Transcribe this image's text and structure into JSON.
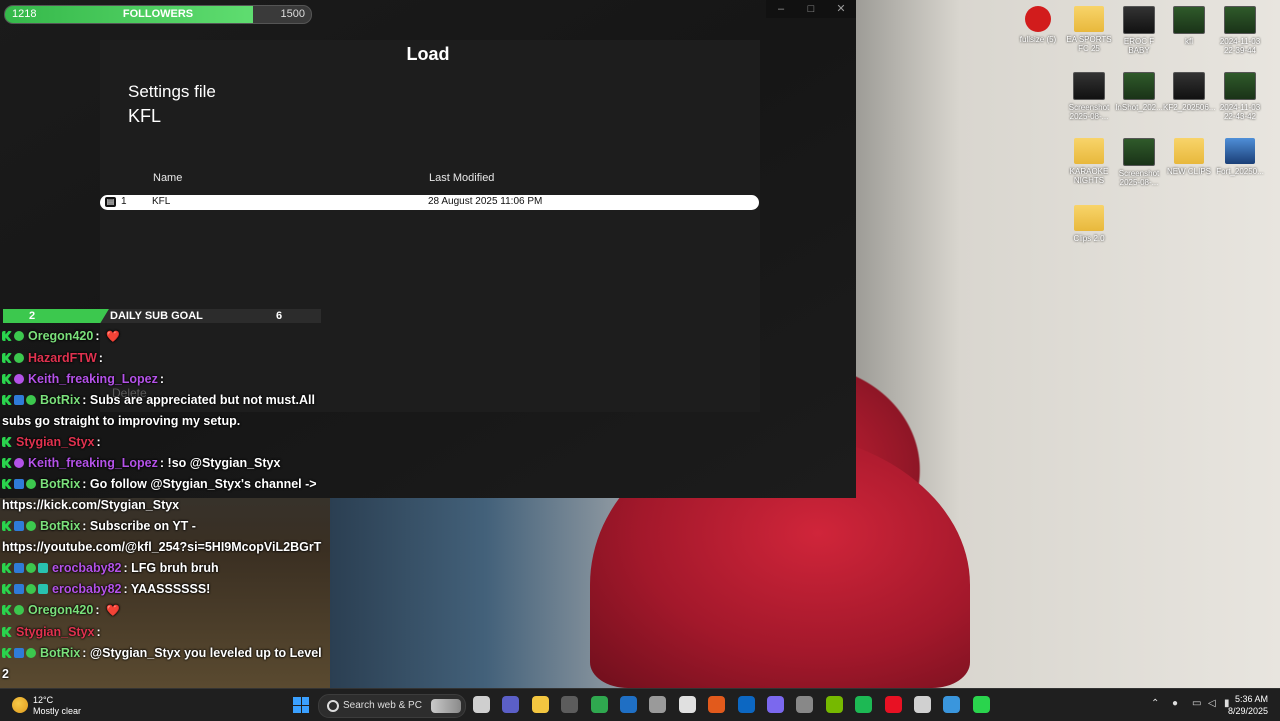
{
  "load_window": {
    "title": "Load",
    "settings_label": "Settings file",
    "settings_name": "KFL",
    "columns": {
      "name": "Name",
      "last_modified": "Last Modified"
    },
    "rows": [
      {
        "index": "1",
        "name": "KFL",
        "modified": "28 August 2025 11:06 PM"
      }
    ],
    "delete_label": "Delete",
    "controls": {
      "minimize": "–",
      "maximize": "□",
      "close": "✕"
    }
  },
  "followers": {
    "current": "1218",
    "label": "FOLLOWERS",
    "goal": "1500",
    "progress": 0.812
  },
  "sub_goal": {
    "current": "2",
    "label": "DAILY SUB GOAL",
    "goal": "6",
    "progress": 0.333
  },
  "chat": [
    {
      "badges": [
        "kick",
        "check"
      ],
      "name": "Oregon420",
      "color": "#7be07b",
      "msg": "",
      "emote": "❤️"
    },
    {
      "badges": [
        "kick",
        "check"
      ],
      "name": "HazardFTW",
      "color": "#e0324f",
      "msg": "",
      "emote": ""
    },
    {
      "badges": [
        "kick",
        "mic"
      ],
      "name": "Keith_freaking_Lopez",
      "color": "#b452e8",
      "msg": "",
      "emote": ""
    },
    {
      "badges": [
        "kick",
        "bot",
        "check"
      ],
      "name": "BotRix",
      "color": "#7be07b",
      "msg": "Subs are appreciated but not must.All subs go straight to improving my setup.",
      "emote": ""
    },
    {
      "badges": [
        "kick"
      ],
      "name": "Stygian_Styx",
      "color": "#e0324f",
      "msg": "",
      "emote": ""
    },
    {
      "badges": [
        "kick",
        "mic"
      ],
      "name": "Keith_freaking_Lopez",
      "color": "#b452e8",
      "msg": "!so @Stygian_Styx",
      "emote": ""
    },
    {
      "badges": [
        "kick",
        "bot",
        "check"
      ],
      "name": "BotRix",
      "color": "#7be07b",
      "msg": "Go follow @Stygian_Styx's channel -> https://kick.com/Stygian_Styx",
      "emote": ""
    },
    {
      "badges": [
        "kick",
        "bot",
        "check"
      ],
      "name": "BotRix",
      "color": "#7be07b",
      "msg": "Subscribe on YT - https://youtube.com/@kfl_254?si=5HI9McopViL2BGrT",
      "emote": ""
    },
    {
      "badges": [
        "kick",
        "bot",
        "check",
        "gift"
      ],
      "name": "erocbaby82",
      "color": "#b452e8",
      "msg": "LFG bruh bruh",
      "emote": ""
    },
    {
      "badges": [
        "kick",
        "bot",
        "check",
        "gift"
      ],
      "name": "erocbaby82",
      "color": "#b452e8",
      "msg": "YAASSSSSS!",
      "emote": ""
    },
    {
      "badges": [
        "kick",
        "check"
      ],
      "name": "Oregon420",
      "color": "#7be07b",
      "msg": "",
      "emote": "❤️"
    },
    {
      "badges": [
        "kick"
      ],
      "name": "Stygian_Styx",
      "color": "#e0324f",
      "msg": "",
      "emote": ""
    },
    {
      "badges": [
        "kick",
        "bot",
        "check"
      ],
      "name": "BotRix",
      "color": "#7be07b",
      "msg": "@Stygian_Styx you leveled up to Level 2",
      "emote": ""
    }
  ],
  "desktop_icons": [
    {
      "label": "fullsize (5)",
      "kind": "red"
    },
    {
      "label": "EA SPORTS FC 25",
      "kind": "folder"
    },
    {
      "label": "EROC F BABY",
      "kind": "video"
    },
    {
      "label": "kfl",
      "kind": "green"
    },
    {
      "label": "2024-11-03 22-39-44",
      "kind": "green"
    },
    {
      "label": "Screenshot 2025-08-...",
      "kind": "video"
    },
    {
      "label": "InShot_202...",
      "kind": "green"
    },
    {
      "label": "KF2_202506...",
      "kind": "video"
    },
    {
      "label": "2024-11-03 22-43-42",
      "kind": "green"
    },
    {
      "label": "KARAOKE NIGHTS",
      "kind": "folder"
    },
    {
      "label": "Screenshot 2025-08-...",
      "kind": "green"
    },
    {
      "label": "NEW CLIPS",
      "kind": "folder"
    },
    {
      "label": "Fort_20250...",
      "kind": "blue"
    },
    {
      "label": "Clips 2.0",
      "kind": "folder"
    }
  ],
  "taskbar": {
    "weather_temp": "12°C",
    "weather_desc": "Mostly clear",
    "search_placeholder": "Search web & PC",
    "time": "5:36 AM",
    "date": "8/29/2025",
    "app_colors": [
      "#cfcfcf",
      "#5b5fc7",
      "#f3c640",
      "#5c5c5c",
      "#2fa84f",
      "#1f6fc4",
      "#9a9a9a",
      "#e0e0e0",
      "#e25a1c",
      "#0c67c2",
      "#7b68ee",
      "#888888",
      "#76b900",
      "#1db954",
      "#e81123",
      "#d0d0d0",
      "#3a96dd",
      "#2ad44d"
    ]
  }
}
